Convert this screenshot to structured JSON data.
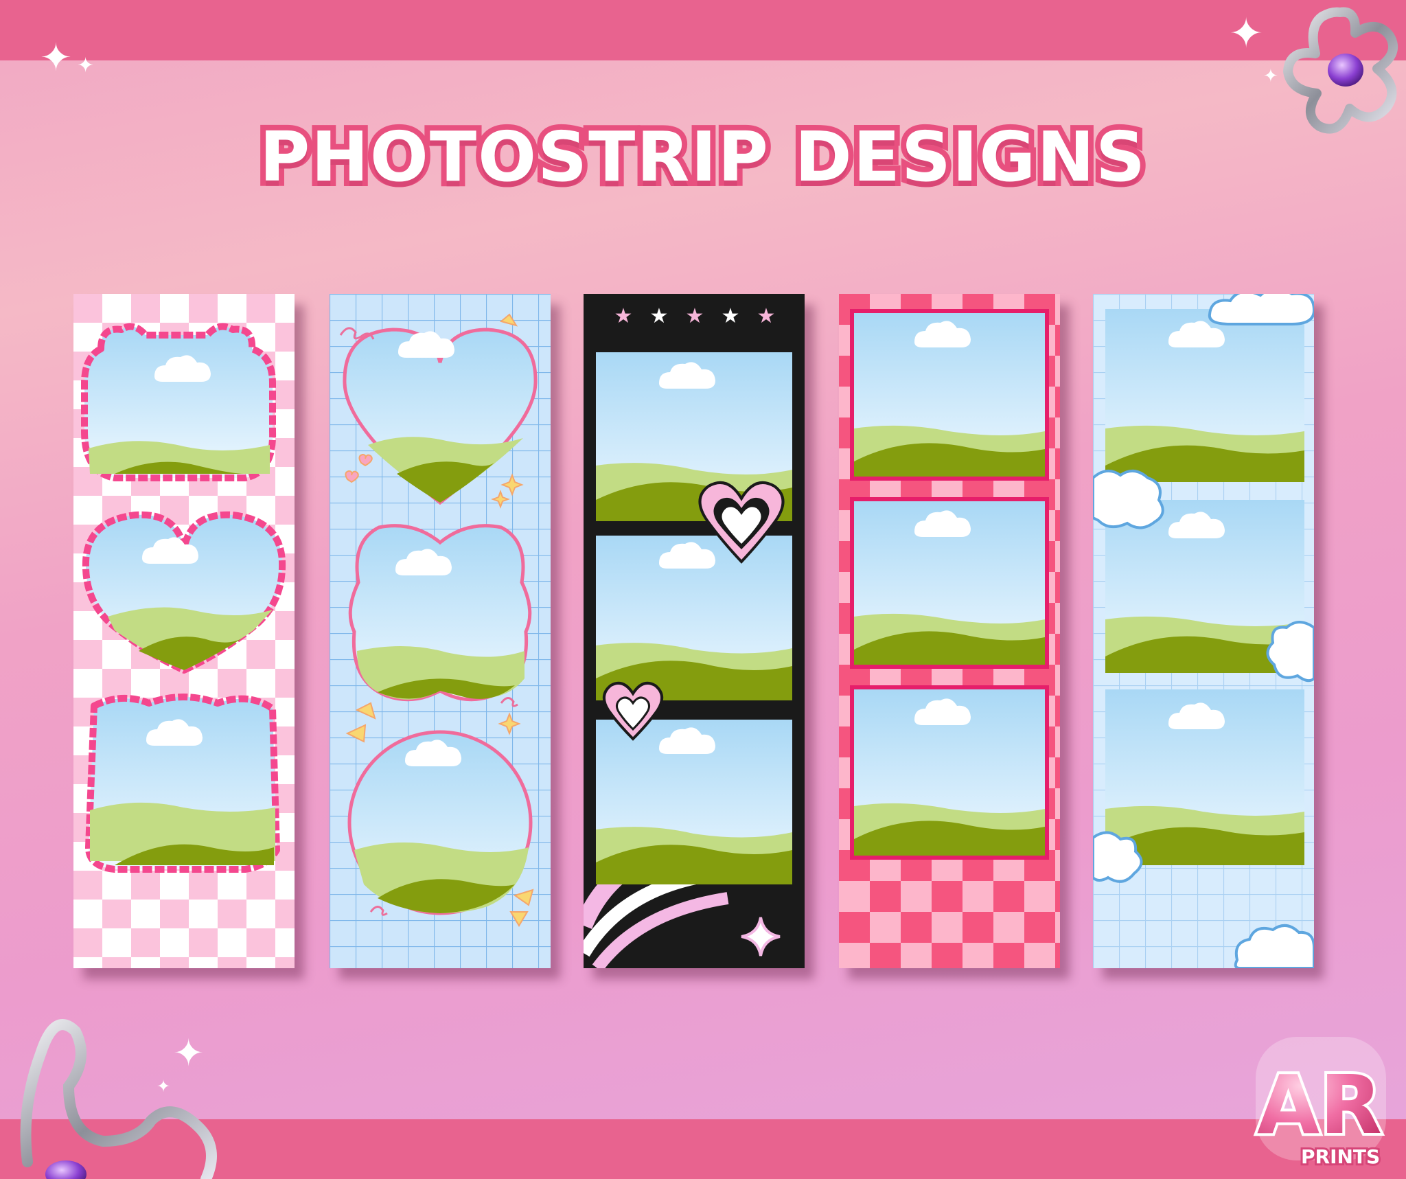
{
  "title": "PHOTOSTRIP DESIGNS",
  "logo": {
    "monogram": "AR",
    "label": "PRINTS"
  },
  "strips": [
    {
      "theme": "pink checkered with scalloped frames",
      "frames": [
        "cloud-top",
        "heart",
        "square"
      ]
    },
    {
      "theme": "blue grid with doodle frames",
      "frames": [
        "heart",
        "flower",
        "circle"
      ]
    },
    {
      "theme": "black with stars and hearts",
      "frames": [
        "rect",
        "rect",
        "rect"
      ]
    },
    {
      "theme": "hot pink checkered",
      "frames": [
        "rect",
        "rect",
        "rect"
      ]
    },
    {
      "theme": "blue grid with clouds",
      "frames": [
        "rect",
        "rect",
        "rect"
      ]
    }
  ],
  "colors": {
    "band": "#e8638f",
    "title_outline": "#e8507f",
    "sky_top": "#a9d8f5",
    "sky_bottom": "#eef8ff",
    "hill_light": "#c2dc84",
    "hill_dark": "#849d0e"
  }
}
